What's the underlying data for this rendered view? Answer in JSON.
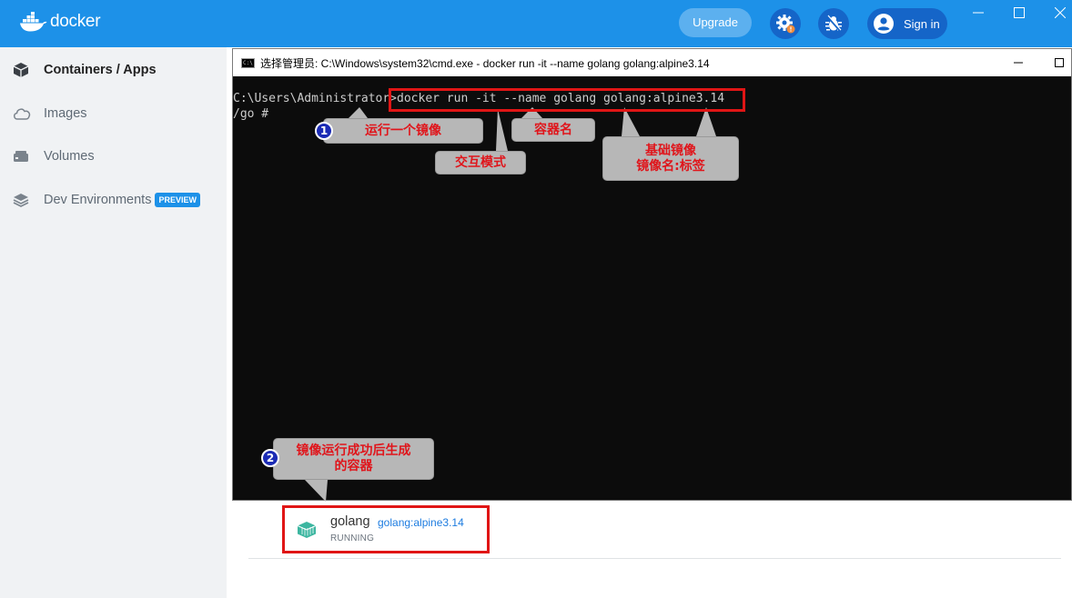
{
  "app": {
    "logo_text": "docker",
    "upgrade_label": "Upgrade",
    "signin_label": "Sign in",
    "brand_color": "#1d91e8"
  },
  "sidebar": {
    "items": [
      {
        "label": "Containers / Apps",
        "icon": "containers-icon",
        "active": true
      },
      {
        "label": "Images",
        "icon": "cloud-icon",
        "active": false
      },
      {
        "label": "Volumes",
        "icon": "volume-icon",
        "active": false
      },
      {
        "label": "Dev Environments",
        "icon": "dev-environments-icon",
        "active": false,
        "badge": "PREVIEW"
      }
    ]
  },
  "cmd": {
    "title": "选择管理员: C:\\Windows\\system32\\cmd.exe - docker  run -it --name golang golang:alpine3.14",
    "icon_text": "C:\\",
    "prompt": "C:\\Users\\Administrator>",
    "command": "docker run -it --name golang golang:alpine3.14",
    "line2": "/go #"
  },
  "annotations": {
    "callout_run": "运行一个镜像",
    "callout_interactive": "交互模式",
    "callout_container_name": "容器名",
    "callout_base_image_1": "基础镜像",
    "callout_base_image_2": "镜像名:标签",
    "callout_generated_1": "镜像运行成功后生成",
    "callout_generated_2": "的容器",
    "badge_1": "1",
    "badge_2": "2",
    "highlight_color": "#e01515"
  },
  "container": {
    "name": "golang",
    "image": "golang:alpine3.14",
    "status": "RUNNING",
    "status_color": "#3cb6a0"
  }
}
